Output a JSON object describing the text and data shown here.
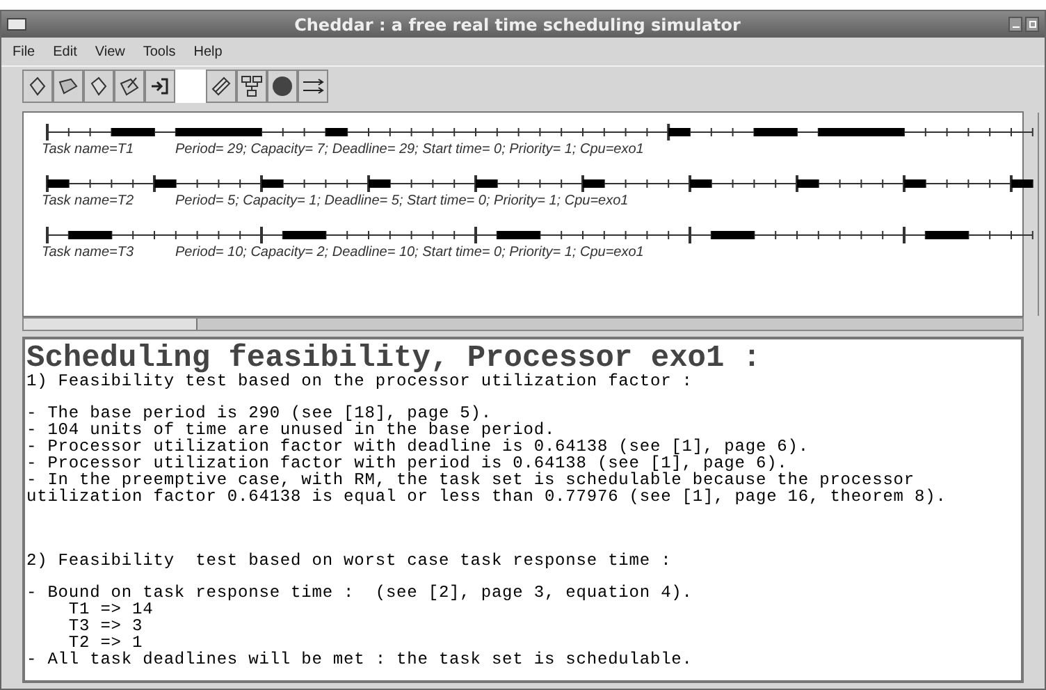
{
  "window": {
    "title": "Cheddar : a free real time scheduling simulator"
  },
  "menu": [
    "File",
    "Edit",
    "View",
    "Tools",
    "Help"
  ],
  "timeline": {
    "tasks": [
      {
        "name": "Task name=T1",
        "details": "Period= 29; Capacity= 7; Deadline= 29; Start time= 0; Priority= 1; Cpu=exo1"
      },
      {
        "name": "Task name=T2",
        "details": "Period= 5; Capacity= 1; Deadline= 5; Start time= 0; Priority= 1; Cpu=exo1"
      },
      {
        "name": "Task name=T3",
        "details": "Period= 10; Capacity= 2; Deadline= 10; Start time= 0; Priority= 1; Cpu=exo1"
      }
    ]
  },
  "report": {
    "title": "Scheduling feasibility, Processor exo1 :",
    "blocks": [
      [
        "1) Feasibility test based on the processor utilization factor :"
      ],
      [
        "- The base period is 290 (see [18], page 5).",
        "- 104 units of time are unused in the base period.",
        "- Processor utilization factor with deadline is 0.64138 (see [1], page 6).",
        "- Processor utilization factor with period is 0.64138 (see [1], page 6).",
        "- In the preemptive case, with RM, the task set is schedulable because the processor",
        "utilization factor 0.64138 is equal or less than 0.77976 (see [1], page 16, theorem 8)."
      ],
      [
        "2) Feasibility  test based on worst case task response time :"
      ],
      [
        "- Bound on task response time :  (see [2], page 3, equation 4).",
        "    T1 => 14",
        "    T3 => 3",
        "    T2 => 1",
        "- All task deadlines will be met : the task set is schedulable."
      ]
    ]
  }
}
